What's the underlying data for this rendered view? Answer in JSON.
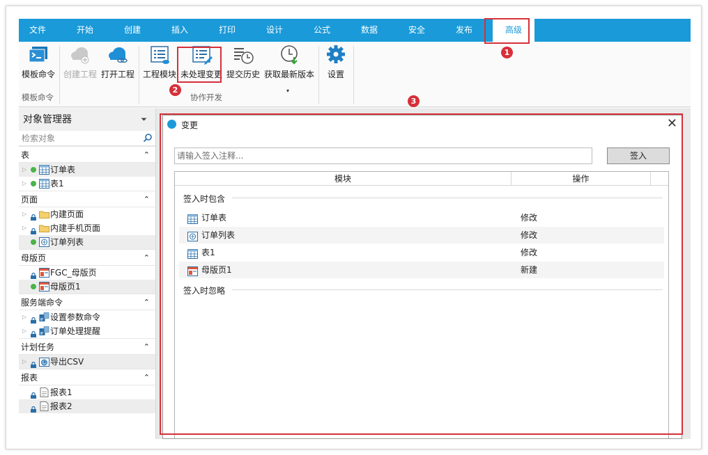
{
  "tabs": [
    "文件",
    "开始",
    "创建",
    "插入",
    "打印",
    "设计",
    "公式",
    "数据",
    "安全",
    "发布",
    "高级"
  ],
  "active_tab": "高级",
  "ribbon": {
    "template_cmd": "模板命令",
    "create_project": "创建工程",
    "open_project": "打开工程",
    "project_module": "工程模块",
    "pending_changes": "未处理变更",
    "commit_history": "提交历史",
    "get_latest": "获取最新版本",
    "settings": "设置",
    "group_template": "模板命令",
    "group_collab": "协作开发"
  },
  "sidebar": {
    "title": "对象管理器",
    "search_placeholder": "检索对象",
    "sections": [
      {
        "label": "表",
        "items": [
          {
            "name": "订单表",
            "icon": "table-icon",
            "status": "ok",
            "expand": true
          },
          {
            "name": "表1",
            "icon": "table-icon",
            "status": "ok",
            "expand": true
          }
        ]
      },
      {
        "label": "页面",
        "items": [
          {
            "name": "内建页面",
            "icon": "folder-icon",
            "status": "lock",
            "expand": true
          },
          {
            "name": "内建手机页面",
            "icon": "folder-icon",
            "status": "lock",
            "expand": true
          },
          {
            "name": "订单列表",
            "icon": "page-icon",
            "status": "ok",
            "expand": false
          }
        ]
      },
      {
        "label": "母版页",
        "items": [
          {
            "name": "FGC_母版页",
            "icon": "master-icon",
            "status": "lock",
            "expand": false
          },
          {
            "name": "母版页1",
            "icon": "master-icon",
            "status": "ok",
            "expand": false
          }
        ]
      },
      {
        "label": "服务端命令",
        "items": [
          {
            "name": "设置参数命令",
            "icon": "command-icon",
            "status": "lock",
            "expand": true
          },
          {
            "name": "订单处理提醒",
            "icon": "command-icon",
            "status": "lock",
            "expand": true
          }
        ]
      },
      {
        "label": "计划任务",
        "items": [
          {
            "name": "导出CSV",
            "icon": "schedule-icon",
            "status": "lock",
            "expand": true
          }
        ]
      },
      {
        "label": "报表",
        "items": [
          {
            "name": "报表1",
            "icon": "report-icon",
            "status": "lock",
            "expand": false
          },
          {
            "name": "报表2",
            "icon": "report-icon",
            "status": "lock",
            "expand": false
          }
        ]
      }
    ]
  },
  "dialog": {
    "title": "变更",
    "comment_placeholder": "请输入签入注释...",
    "checkin_label": "签入",
    "col_module": "模块",
    "col_action": "操作",
    "group_included": "签入时包含",
    "group_ignored": "签入时忽略",
    "rows": [
      {
        "name": "订单表",
        "icon": "table-icon",
        "action": "修改"
      },
      {
        "name": "订单列表",
        "icon": "page-icon",
        "action": "修改"
      },
      {
        "name": "表1",
        "icon": "table-icon",
        "action": "修改"
      },
      {
        "name": "母版页1",
        "icon": "master-icon",
        "action": "新建"
      }
    ]
  },
  "annotations": [
    "1",
    "2",
    "3"
  ],
  "colors": {
    "accent": "#1a9ad8",
    "marker": "#d6303a",
    "ok": "#4bb34b"
  }
}
